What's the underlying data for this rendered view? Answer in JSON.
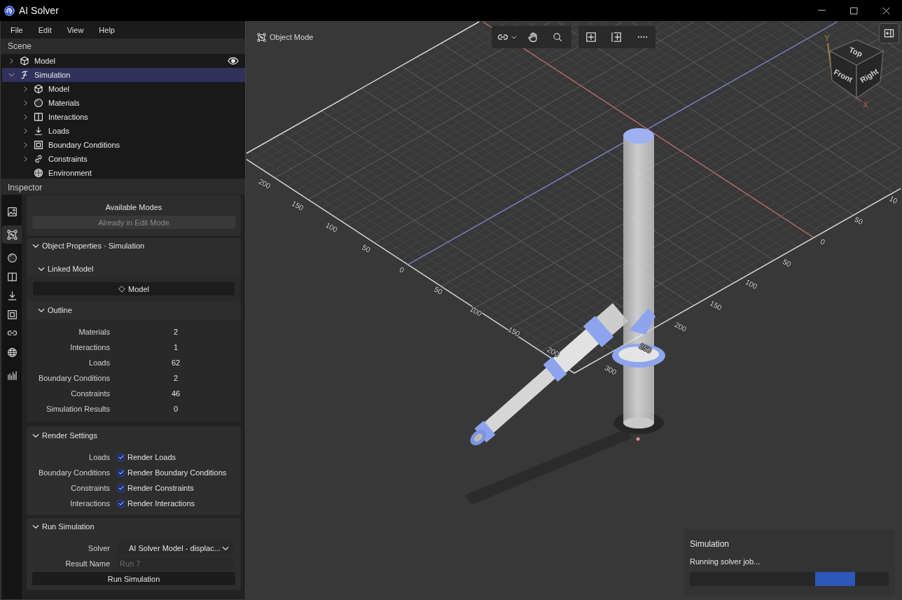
{
  "window": {
    "title": "AI Solver"
  },
  "menu": [
    "File",
    "Edit",
    "View",
    "Help"
  ],
  "scene": {
    "title": "Scene",
    "items": [
      {
        "label": "Model",
        "kind": "group",
        "expanded": false,
        "selected": false,
        "visible": true
      },
      {
        "label": "Simulation",
        "kind": "group",
        "expanded": true,
        "selected": true,
        "children": [
          {
            "label": "Model",
            "kind": "group",
            "expanded": false,
            "selected": false
          },
          {
            "label": "Materials",
            "kind": "group",
            "expanded": false,
            "selected": false
          },
          {
            "label": "Interactions",
            "kind": "group",
            "expanded": false,
            "selected": false
          },
          {
            "label": "Loads",
            "kind": "group",
            "expanded": false,
            "selected": false
          },
          {
            "label": "Boundary Conditions",
            "kind": "group",
            "expanded": false,
            "selected": false
          },
          {
            "label": "Constraints",
            "kind": "group",
            "expanded": false,
            "selected": false
          },
          {
            "label": "Environment",
            "kind": "leaf",
            "selected": false
          }
        ]
      }
    ]
  },
  "inspector": {
    "title": "Inspector",
    "side_tabs": [
      {
        "selected": false
      },
      {
        "selected": true
      },
      {
        "selected": false
      },
      {
        "selected": false
      },
      {
        "selected": false
      },
      {
        "selected": false
      },
      {
        "selected": false
      },
      {
        "selected": false
      },
      {
        "selected": false
      }
    ],
    "modes": {
      "title": "Available Modes",
      "button": {
        "label": "Already in Edit Mode",
        "disabled": true
      }
    },
    "object_properties": {
      "title": "Object Properties · Simulation",
      "expanded": true,
      "linked_model": {
        "title": "Linked Model",
        "expanded": true,
        "button": "Model"
      },
      "outline": {
        "title": "Outline",
        "expanded": true,
        "rows": [
          {
            "label": "Materials",
            "value": "2"
          },
          {
            "label": "Interactions",
            "value": "1"
          },
          {
            "label": "Loads",
            "value": "62"
          },
          {
            "label": "Boundary Conditions",
            "value": "2"
          },
          {
            "label": "Constraints",
            "value": "46"
          },
          {
            "label": "Simulation Results",
            "value": "0"
          }
        ]
      }
    },
    "render_settings": {
      "title": "Render Settings",
      "expanded": true,
      "rows": [
        {
          "label": "Loads",
          "option": "Render Loads",
          "checked": true
        },
        {
          "label": "Boundary Conditions",
          "option": "Render Boundary Conditions",
          "checked": true
        },
        {
          "label": "Constraints",
          "option": "Render Constraints",
          "checked": true
        },
        {
          "label": "Interactions",
          "option": "Render Interactions",
          "checked": true
        }
      ]
    },
    "run_simulation": {
      "title": "Run Simulation",
      "expanded": true,
      "solver": {
        "label": "Solver",
        "value": "AI Solver Model - displac..."
      },
      "result_name": {
        "label": "Result Name",
        "placeholder": "Run 7"
      },
      "button": "Run Simulation"
    }
  },
  "viewport": {
    "mode": "Object Mode",
    "grid_labels": {
      "left_edge": [
        "200",
        "150",
        "100",
        "50",
        "0",
        "50",
        "100",
        "150",
        "200"
      ],
      "right_edge": [
        "300",
        "250",
        "200",
        "150",
        "100",
        "50",
        "0",
        "50",
        "10"
      ]
    },
    "view_cube": {
      "faces": [
        "Top",
        "Front",
        "Right"
      ],
      "axes": [
        "Y",
        "X"
      ]
    }
  },
  "simulation_panel": {
    "title": "Simulation",
    "status": "Running solver job...",
    "progress": {
      "indeterminate": true
    }
  }
}
